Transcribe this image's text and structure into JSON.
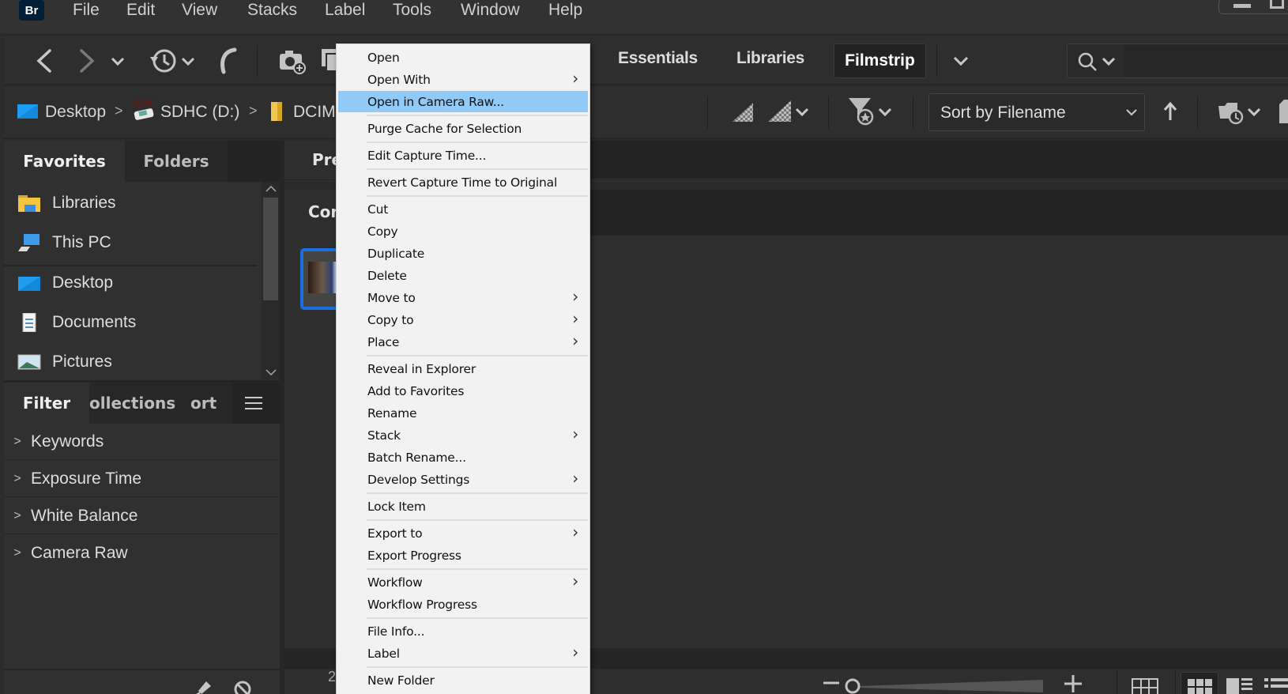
{
  "app": {
    "logo": "Br"
  },
  "menubar": {
    "items": [
      "File",
      "Edit",
      "View",
      "Stacks",
      "Label",
      "Tools",
      "Window",
      "Help"
    ]
  },
  "toolbar": {
    "icons": [
      "back-icon",
      "forward-icon",
      "chevron-down-icon",
      "recent-history-icon",
      "boomerang-icon",
      "camera-import-icon",
      "copy-icon"
    ],
    "workspaces": [
      "Essentials",
      "Libraries",
      "Filmstrip"
    ],
    "active_workspace": "Filmstrip",
    "search": {
      "placeholder": "",
      "value": ""
    }
  },
  "pathbar": {
    "crumbs": [
      {
        "label": "Desktop",
        "icon": "desktop-icon"
      },
      {
        "label": "SDHC (D:)",
        "icon": "sd-card-icon"
      },
      {
        "label": "DCIM",
        "icon": "folder-icon"
      }
    ],
    "sort": {
      "label": "Sort by Filename"
    }
  },
  "leftpanel": {
    "tabs": [
      "Favorites",
      "Folders"
    ],
    "favorites": [
      {
        "label": "Libraries",
        "icon": "libraries-icon"
      },
      {
        "label": "This PC",
        "icon": "this-pc-icon"
      },
      {
        "label": "Desktop",
        "icon": "desktop-icon"
      },
      {
        "label": "Documents",
        "icon": "documents-icon"
      },
      {
        "label": "Pictures",
        "icon": "pictures-icon"
      }
    ],
    "lower_tabs": [
      "Filter",
      "ollections",
      "ort"
    ],
    "filters": [
      "Keywords",
      "Exposure Time",
      "White Balance",
      "Camera Raw"
    ]
  },
  "content": {
    "preview_tab": "Pre",
    "content_tab": "Con",
    "status_text": "2"
  },
  "context_menu": {
    "groups": [
      [
        {
          "label": "Open",
          "sub": false
        },
        {
          "label": "Open With",
          "sub": true
        },
        {
          "label": "Open in Camera Raw...",
          "sub": false,
          "highlighted": true
        }
      ],
      [
        {
          "label": "Purge Cache for Selection",
          "sub": false
        }
      ],
      [
        {
          "label": "Edit Capture Time...",
          "sub": false
        }
      ],
      [
        {
          "label": "Revert Capture Time to Original",
          "sub": false
        }
      ],
      [
        {
          "label": "Cut",
          "sub": false
        },
        {
          "label": "Copy",
          "sub": false
        },
        {
          "label": "Duplicate",
          "sub": false
        },
        {
          "label": "Delete",
          "sub": false
        },
        {
          "label": "Move to",
          "sub": true
        },
        {
          "label": "Copy to",
          "sub": true
        },
        {
          "label": "Place",
          "sub": true
        }
      ],
      [
        {
          "label": "Reveal in Explorer",
          "sub": false
        },
        {
          "label": "Add to Favorites",
          "sub": false
        },
        {
          "label": "Rename",
          "sub": false
        },
        {
          "label": "Stack",
          "sub": true
        },
        {
          "label": "Batch Rename...",
          "sub": false
        },
        {
          "label": "Develop Settings",
          "sub": true
        }
      ],
      [
        {
          "label": "Lock Item",
          "sub": false
        }
      ],
      [
        {
          "label": "Export to",
          "sub": true
        },
        {
          "label": "Export Progress",
          "sub": false
        }
      ],
      [
        {
          "label": "Workflow",
          "sub": true
        },
        {
          "label": "Workflow Progress",
          "sub": false
        }
      ],
      [
        {
          "label": "File Info...",
          "sub": false
        },
        {
          "label": "Label",
          "sub": true
        }
      ],
      [
        {
          "label": "New Folder",
          "sub": false
        }
      ]
    ]
  },
  "colors": {
    "highlight": "#91c9f7",
    "selection_border": "#1a6fe0",
    "app_bg": "#2b2b2b"
  }
}
